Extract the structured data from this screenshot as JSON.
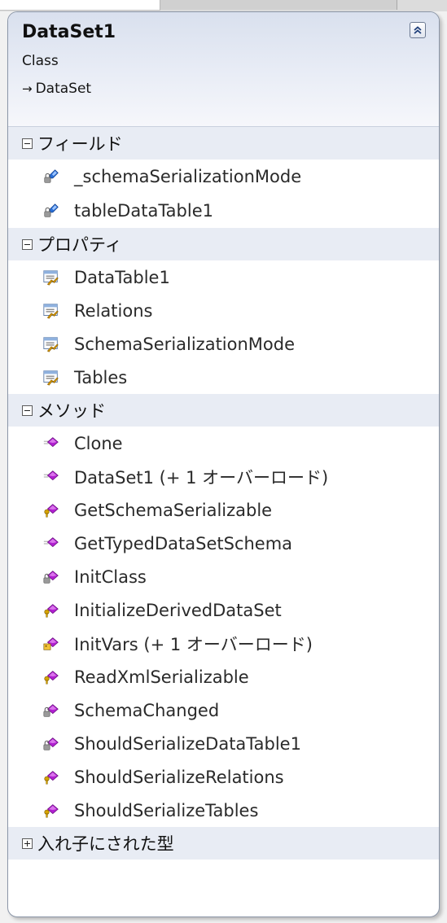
{
  "class_shape": {
    "name": "DataSet1",
    "kind": "Class",
    "base": "DataSet",
    "base_arrow": "→",
    "collapse_icon": "double-chevron-up-icon"
  },
  "sections": {
    "fields": {
      "title": "フィールド",
      "expanded": true,
      "members": [
        {
          "name": "_schemaSerializationMode",
          "icon": "private-field-icon"
        },
        {
          "name": "tableDataTable1",
          "icon": "private-field-icon"
        }
      ]
    },
    "properties": {
      "title": "プロパティ",
      "expanded": true,
      "members": [
        {
          "name": "DataTable1",
          "icon": "property-icon"
        },
        {
          "name": "Relations",
          "icon": "property-icon"
        },
        {
          "name": "SchemaSerialization​Mode",
          "icon": "property-icon"
        },
        {
          "name": "Tables",
          "icon": "property-icon"
        }
      ]
    },
    "methods": {
      "title": "メソッド",
      "expanded": true,
      "members": [
        {
          "name": "Clone",
          "icon": "public-method-icon"
        },
        {
          "name": "DataSet1 (+ 1 オーバーロード)",
          "icon": "public-method-icon"
        },
        {
          "name": "GetSchemaSerializable",
          "icon": "protected-method-icon"
        },
        {
          "name": "GetTypedDataSetSchema",
          "icon": "public-method-icon"
        },
        {
          "name": "InitClass",
          "icon": "private-method-icon"
        },
        {
          "name": "InitializeDerivedDataSet",
          "icon": "protected-method-icon"
        },
        {
          "name": "InitVars (+ 1 オーバーロード)",
          "icon": "internal-method-icon"
        },
        {
          "name": "ReadXmlSerializable",
          "icon": "protected-method-icon"
        },
        {
          "name": "SchemaChanged",
          "icon": "private-method-icon"
        },
        {
          "name": "ShouldSerializeDataTable1",
          "icon": "private-method-icon"
        },
        {
          "name": "ShouldSerializeRelations",
          "icon": "protected-method-icon"
        },
        {
          "name": "ShouldSerializeTables",
          "icon": "protected-method-icon"
        }
      ]
    },
    "nested_types": {
      "title": "入れ子にされた型",
      "expanded": false,
      "members": []
    }
  },
  "colors": {
    "header_bg": "#dde3f0",
    "section_bg": "#e8ecf4",
    "method_purple": "#b01fd0",
    "field_blue": "#2a6fd6",
    "protected_key_gold": "#d8a400",
    "property_hand_gold": "#e0a200"
  }
}
